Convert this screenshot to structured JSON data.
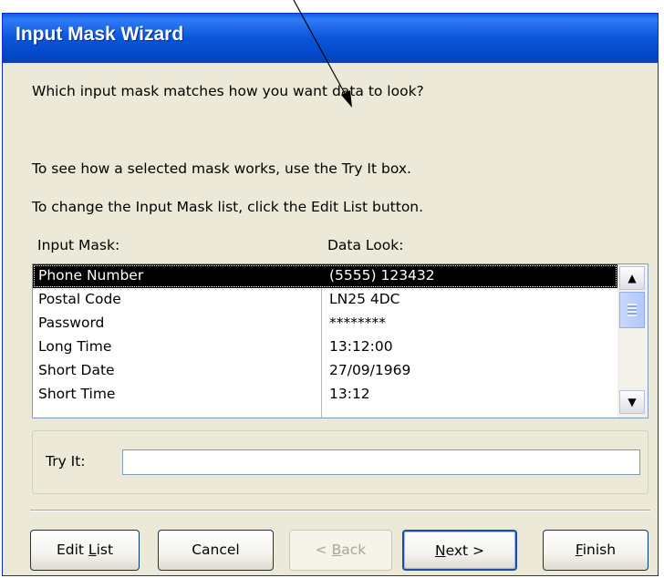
{
  "window": {
    "title": "Input Mask Wizard"
  },
  "instructions": {
    "question": "Which input mask matches how you want data to look?",
    "try_it_hint": "To see how a selected mask works, use the Try It box.",
    "edit_list_hint": "To change the Input Mask list, click the Edit List button."
  },
  "list": {
    "header_mask": "Input Mask:",
    "header_look": "Data Look:",
    "rows": [
      {
        "mask": "Phone Number",
        "look": "(5555) 123432",
        "selected": true
      },
      {
        "mask": "Postal Code",
        "look": "LN25 4DC"
      },
      {
        "mask": "Password",
        "look": "********"
      },
      {
        "mask": "Long Time",
        "look": "13:12:00"
      },
      {
        "mask": "Short Date",
        "look": "27/09/1969"
      },
      {
        "mask": "Short Time",
        "look": "13:12"
      }
    ]
  },
  "try_it": {
    "label": "Try It:",
    "value": ""
  },
  "buttons": {
    "edit_list_pre": "Edit ",
    "edit_list_acc": "L",
    "edit_list_post": "ist",
    "cancel": "Cancel",
    "back_pre": "< ",
    "back_acc": "B",
    "back_post": "ack",
    "next_acc": "N",
    "next_post": "ext >",
    "finish_acc": "F",
    "finish_post": "inish"
  },
  "icons": {
    "scroll_up": "▲",
    "scroll_down": "▼"
  }
}
